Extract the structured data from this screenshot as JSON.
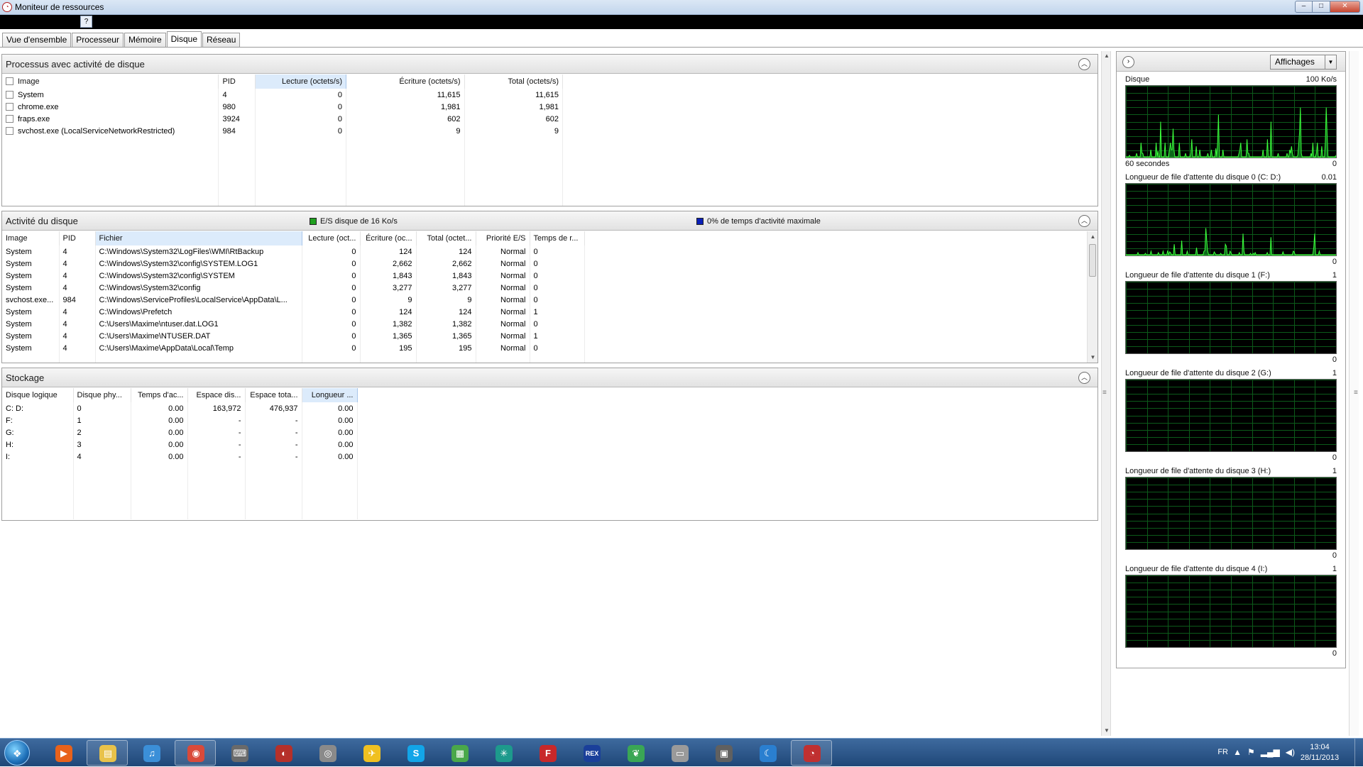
{
  "window": {
    "title": "Moniteur de ressources",
    "help": "?",
    "buttons": {
      "minimize": "–",
      "maximize": "□",
      "close": "✕"
    }
  },
  "tabs": [
    "Vue d'ensemble",
    "Processeur",
    "Mémoire",
    "Disque",
    "Réseau"
  ],
  "active_tab": "Disque",
  "processes": {
    "title": "Processus avec activité de disque",
    "columns": [
      "Image",
      "PID",
      "Lecture (octets/s)",
      "Écriture (octets/s)",
      "Total (octets/s)"
    ],
    "rows": [
      [
        "System",
        "4",
        "0",
        "11,615",
        "11,615"
      ],
      [
        "chrome.exe",
        "980",
        "0",
        "1,981",
        "1,981"
      ],
      [
        "fraps.exe",
        "3924",
        "0",
        "602",
        "602"
      ],
      [
        "svchost.exe (LocalServiceNetworkRestricted)",
        "984",
        "0",
        "9",
        "9"
      ]
    ]
  },
  "activity": {
    "title": "Activité du disque",
    "legend_io": "E/S disque de 16 Ko/s",
    "legend_active": "0% de temps d'activité maximale",
    "legend_io_color": "#1fa01f",
    "legend_active_color": "#0a1fb8",
    "columns": [
      "Image",
      "PID",
      "Fichier",
      "Lecture (oct...",
      "Écriture (oc...",
      "Total (octet...",
      "Priorité E/S",
      "Temps de r..."
    ],
    "rows": [
      [
        "System",
        "4",
        "C:\\Windows\\System32\\LogFiles\\WMI\\RtBackup",
        "0",
        "124",
        "124",
        "Normal",
        "0"
      ],
      [
        "System",
        "4",
        "C:\\Windows\\System32\\config\\SYSTEM.LOG1",
        "0",
        "2,662",
        "2,662",
        "Normal",
        "0"
      ],
      [
        "System",
        "4",
        "C:\\Windows\\System32\\config\\SYSTEM",
        "0",
        "1,843",
        "1,843",
        "Normal",
        "0"
      ],
      [
        "System",
        "4",
        "C:\\Windows\\System32\\config",
        "0",
        "3,277",
        "3,277",
        "Normal",
        "0"
      ],
      [
        "svchost.exe...",
        "984",
        "C:\\Windows\\ServiceProfiles\\LocalService\\AppData\\L...",
        "0",
        "9",
        "9",
        "Normal",
        "0"
      ],
      [
        "System",
        "4",
        "C:\\Windows\\Prefetch",
        "0",
        "124",
        "124",
        "Normal",
        "1"
      ],
      [
        "System",
        "4",
        "C:\\Users\\Maxime\\ntuser.dat.LOG1",
        "0",
        "1,382",
        "1,382",
        "Normal",
        "0"
      ],
      [
        "System",
        "4",
        "C:\\Users\\Maxime\\NTUSER.DAT",
        "0",
        "1,365",
        "1,365",
        "Normal",
        "1"
      ],
      [
        "System",
        "4",
        "C:\\Users\\Maxime\\AppData\\Local\\Temp",
        "0",
        "195",
        "195",
        "Normal",
        "0"
      ]
    ]
  },
  "storage": {
    "title": "Stockage",
    "columns": [
      "Disque logique",
      "Disque phy...",
      "Temps d'ac...",
      "Espace dis...",
      "Espace tota...",
      "Longueur ..."
    ],
    "rows": [
      [
        "C: D:",
        "0",
        "0.00",
        "163,972",
        "476,937",
        "0.00"
      ],
      [
        "F:",
        "1",
        "0.00",
        "-",
        "-",
        "0.00"
      ],
      [
        "G:",
        "2",
        "0.00",
        "-",
        "-",
        "0.00"
      ],
      [
        "H:",
        "3",
        "0.00",
        "-",
        "-",
        "0.00"
      ],
      [
        "I:",
        "4",
        "0.00",
        "-",
        "-",
        "0.00"
      ]
    ]
  },
  "graphs_panel": {
    "views_label": "Affichages",
    "graphs": [
      {
        "title": "Disque",
        "max": "100 Ko/s",
        "footer_left": "60 secondes",
        "footer_right": "0",
        "values": [
          0,
          0,
          0,
          0,
          0.02,
          0,
          0,
          0,
          0,
          0,
          0,
          0,
          0.05,
          0,
          0,
          0,
          0,
          0.2,
          0.05,
          0.05,
          0,
          0,
          0,
          0,
          0,
          0,
          0,
          0,
          0.1,
          0,
          0,
          0,
          0,
          0,
          0.2,
          0,
          0.08,
          0,
          0,
          0.5,
          0,
          0,
          0,
          0,
          0.2,
          0,
          0,
          0,
          0,
          0.1,
          0.2,
          0.1,
          0.1,
          0.4,
          0.1,
          0,
          0,
          0,
          0,
          0,
          0.2,
          0,
          0,
          0,
          0,
          0,
          0,
          0.05,
          0,
          0,
          0,
          0,
          0,
          0.06,
          0.25,
          0,
          0,
          0,
          0,
          0.15,
          0,
          0,
          0,
          0.1,
          0,
          0,
          0,
          0,
          0,
          0,
          0,
          0,
          0.05,
          0,
          0,
          0,
          0.1,
          0,
          0,
          0,
          0,
          0.12,
          0,
          0.2,
          0.6,
          0,
          0,
          0,
          0,
          0.1,
          0,
          0,
          0,
          0,
          0,
          0,
          0,
          0,
          0,
          0,
          0,
          0,
          0,
          0,
          0,
          0,
          0,
          0.05,
          0.1,
          0.2,
          0,
          0,
          0,
          0,
          0,
          0,
          0.25,
          0.05,
          0.05,
          0,
          0,
          0,
          0,
          0,
          0,
          0,
          0,
          0,
          0,
          0,
          0,
          0,
          0,
          0,
          0.1,
          0,
          0,
          0,
          0,
          0.25,
          0,
          0,
          0,
          0.5,
          0,
          0,
          0,
          0,
          0,
          0,
          0,
          0.05,
          0,
          0,
          0,
          0,
          0,
          0,
          0,
          0,
          0,
          0.05,
          0,
          0,
          0.1,
          0.05,
          0.15,
          0.05,
          0,
          0,
          0,
          0,
          0,
          0.02,
          0.15,
          0.35,
          0.7,
          0.05,
          0,
          0,
          0,
          0,
          0,
          0,
          0,
          0,
          0,
          0,
          0.05,
          0,
          0.2,
          0,
          0,
          0,
          0.05,
          0.2,
          0,
          0,
          0,
          0,
          0.15,
          0,
          0,
          0,
          0.2,
          0.7,
          0.3,
          0,
          0,
          0,
          0,
          0,
          0,
          0,
          0,
          0,
          0.02
        ]
      },
      {
        "title": "Longueur de file d'attente du disque 0 (C: D:)",
        "max": "0.01",
        "footer_right": "0",
        "values": [
          0,
          0,
          0,
          0,
          0,
          0,
          0,
          0,
          0,
          0,
          0,
          0,
          0,
          0.03,
          0,
          0,
          0,
          0,
          0,
          0,
          0,
          0.02,
          0,
          0,
          0,
          0,
          0,
          0.05,
          0,
          0,
          0,
          0,
          0,
          0,
          0,
          0.03,
          0,
          0,
          0,
          0,
          0.05,
          0,
          0,
          0,
          0,
          0.06,
          0,
          0.04,
          0.03,
          0,
          0,
          0,
          0.15,
          0,
          0,
          0,
          0,
          0,
          0,
          0,
          0.2,
          0,
          0,
          0,
          0,
          0,
          0.05,
          0,
          0,
          0,
          0,
          0,
          0,
          0,
          0,
          0,
          0.1,
          0,
          0,
          0,
          0,
          0,
          0,
          0,
          0.05,
          0.06,
          0.38,
          0.2,
          0.05,
          0,
          0,
          0,
          0,
          0,
          0,
          0.04,
          0.02,
          0,
          0,
          0,
          0,
          0,
          0.02,
          0,
          0,
          0,
          0,
          0.15,
          0.12,
          0,
          0,
          0,
          0.05,
          0.03,
          0,
          0,
          0,
          0,
          0,
          0,
          0,
          0,
          0.03,
          0,
          0,
          0,
          0.3,
          0.05,
          0,
          0,
          0,
          0,
          0,
          0,
          0.02,
          0,
          0,
          0.02,
          0,
          0.03,
          0,
          0,
          0,
          0,
          0,
          0,
          0,
          0,
          0,
          0,
          0,
          0,
          0.03,
          0,
          0,
          0,
          0.25,
          0,
          0,
          0,
          0,
          0,
          0,
          0,
          0,
          0,
          0,
          0,
          0,
          0.04,
          0,
          0,
          0,
          0,
          0,
          0,
          0,
          0,
          0,
          0,
          0.05,
          0.04,
          0,
          0,
          0,
          0,
          0,
          0,
          0,
          0,
          0,
          0,
          0,
          0,
          0,
          0,
          0,
          0,
          0,
          0,
          0,
          0,
          0.1,
          0.3,
          0,
          0,
          0,
          0,
          0.05,
          0,
          0,
          0,
          0,
          0,
          0,
          0,
          0,
          0,
          0,
          0,
          0,
          0,
          0,
          0,
          0,
          0,
          0
        ]
      },
      {
        "title": "Longueur de file d'attente du disque 1 (F:)",
        "max": "1",
        "footer_right": "0",
        "values": []
      },
      {
        "title": "Longueur de file d'attente du disque 2 (G:)",
        "max": "1",
        "footer_right": "0",
        "values": []
      },
      {
        "title": "Longueur de file d'attente du disque 3 (H:)",
        "max": "1",
        "footer_right": "0",
        "values": []
      },
      {
        "title": "Longueur de file d'attente du disque 4 (I:)",
        "max": "1",
        "footer_right": "0",
        "values": []
      }
    ]
  },
  "taskbar": {
    "apps": [
      {
        "name": "media-player-icon",
        "glyph": "▶",
        "color": "#e8621b"
      },
      {
        "name": "explorer-icon",
        "glyph": "▤",
        "color": "#e8c24a"
      },
      {
        "name": "itunes-icon",
        "glyph": "♫",
        "color": "#3b8fd8"
      },
      {
        "name": "chrome-icon",
        "glyph": "◉",
        "color": "#d94a3a"
      },
      {
        "name": "keyboard-icon",
        "glyph": "⌨",
        "color": "#6a6a6a"
      },
      {
        "name": "speedometer-icon",
        "glyph": "◐",
        "color": "#b5302a"
      },
      {
        "name": "disc-icon",
        "glyph": "◎",
        "color": "#8a8a8a"
      },
      {
        "name": "airplane-icon",
        "glyph": "✈",
        "color": "#f0c020"
      },
      {
        "name": "skype-icon",
        "glyph": "S",
        "color": "#12a5e8"
      },
      {
        "name": "color-palette-icon",
        "glyph": "▦",
        "color": "#4aa84a"
      },
      {
        "name": "antenna-icon",
        "glyph": "✳",
        "color": "#1d9a8c"
      },
      {
        "name": "fraps-icon",
        "glyph": "F",
        "color": "#c8282a"
      },
      {
        "name": "rex-icon",
        "glyph": "REX",
        "color": "#1a3f9a"
      },
      {
        "name": "evernote-icon",
        "glyph": "❦",
        "color": "#3aa655"
      },
      {
        "name": "document-icon",
        "glyph": "▭",
        "color": "#9a9a9a"
      },
      {
        "name": "monitor-icon",
        "glyph": "▣",
        "color": "#606060"
      },
      {
        "name": "moon-icon",
        "glyph": "☾",
        "color": "#2a7fd0"
      },
      {
        "name": "resource-monitor-icon",
        "glyph": "◔",
        "color": "#c03030"
      }
    ],
    "lang": "FR",
    "time": "13:04",
    "date": "28/11/2013"
  }
}
